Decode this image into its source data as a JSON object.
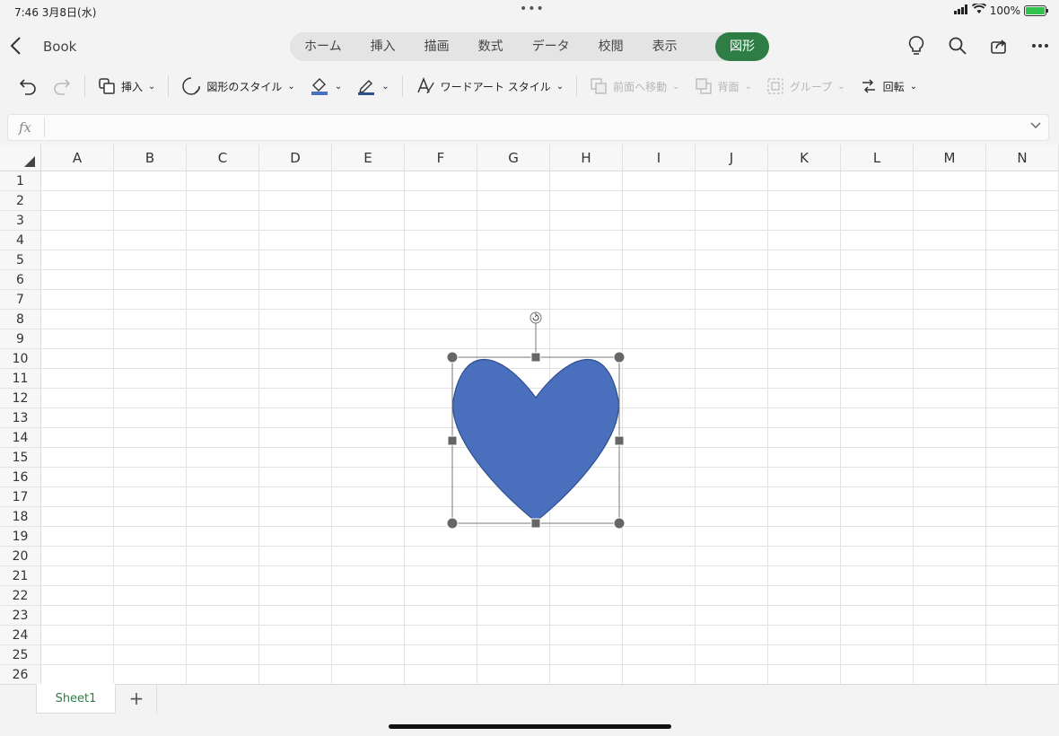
{
  "status": {
    "time_date": "7:46  3月8日(水)",
    "battery": "100%"
  },
  "nav": {
    "doc_title": "Book",
    "tabs": [
      "ホーム",
      "挿入",
      "描画",
      "数式",
      "データ",
      "校閲",
      "表示"
    ],
    "active_tab": "図形"
  },
  "ribbon": {
    "insert": "挿入",
    "shape_style": "図形のスタイル",
    "wordart": "ワードアート スタイル",
    "bring_forward": "前面へ移動",
    "send_back": "背面",
    "group": "グループ",
    "rotate": "回転"
  },
  "formula": {
    "fx": "fx"
  },
  "sheet": {
    "columns": [
      "A",
      "B",
      "C",
      "D",
      "E",
      "F",
      "G",
      "H",
      "I",
      "J",
      "K",
      "L",
      "M",
      "N"
    ],
    "rows": [
      "1",
      "2",
      "3",
      "4",
      "5",
      "6",
      "7",
      "8",
      "9",
      "10",
      "11",
      "12",
      "13",
      "14",
      "15",
      "16",
      "17",
      "18",
      "19",
      "20",
      "21",
      "22",
      "23",
      "24",
      "25",
      "26"
    ],
    "tab_name": "Sheet1",
    "add_label": "+"
  },
  "shape": {
    "type": "heart",
    "fill": "#4a6fbc",
    "stroke": "#2f4f8f"
  },
  "colors": {
    "accent": "#2e7d45"
  }
}
